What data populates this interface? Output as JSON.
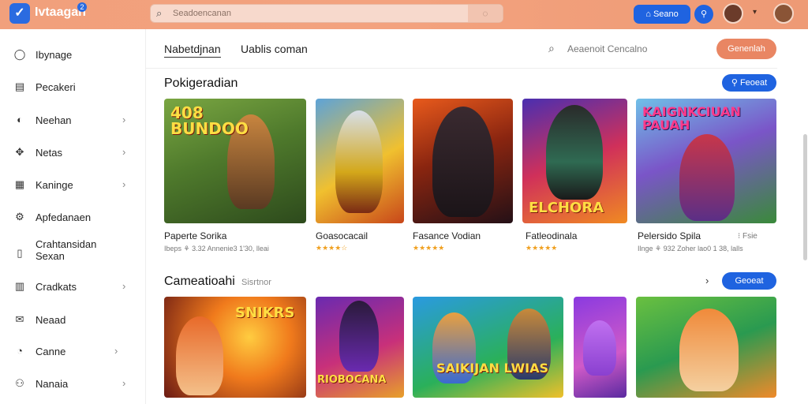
{
  "app": {
    "brand": "Ivtaagan",
    "brand_badge": "2",
    "logo_icon": "checkmark-logo-icon"
  },
  "topbar": {
    "search_placeholder": "Seadoencanan",
    "search_icon": "search-icon",
    "primary_button": "Seano",
    "icon_button": "profile-icon",
    "colors": {
      "bar": "#f1a07c",
      "accent": "#1f63e0"
    }
  },
  "sidebar": {
    "items": [
      {
        "label": "Ibynage",
        "icon": "home-icon",
        "chevron": ""
      },
      {
        "label": "Pecakeri",
        "icon": "clipboard-icon",
        "chevron": ""
      },
      {
        "label": "Neehan",
        "icon": "gamepad-icon",
        "chevron": "›"
      },
      {
        "label": "Netas",
        "icon": "puzzle-icon",
        "chevron": "›"
      },
      {
        "label": "Kaninge",
        "icon": "calendar-icon",
        "chevron": "›"
      },
      {
        "label": "Apfedanaen",
        "icon": "gear-icon",
        "chevron": ""
      },
      {
        "label": "Crahtansidan Sexan",
        "icon": "file-icon",
        "chevron": ""
      },
      {
        "label": "Cradkats",
        "icon": "grid-icon",
        "chevron": "›"
      },
      {
        "label": "Neaad",
        "icon": "mail-icon",
        "chevron": ""
      },
      {
        "label": "Canne",
        "icon": "help-icon",
        "chevron": "›"
      },
      {
        "label": "Nanaia",
        "icon": "user-icon",
        "chevron": "›"
      }
    ]
  },
  "main": {
    "tabs": [
      {
        "label": "Nabetdjnan"
      },
      {
        "label": "Uablis coman"
      }
    ],
    "sub_search_placeholder": "Aeaenoit Cencalno",
    "orange_button": "Genenlah",
    "section1": {
      "title": "Pokigeradian",
      "button": "Feoeat",
      "cards": [
        {
          "title": "Paperte Sorika",
          "meta": "Ibeps ⚘ 3.32 Annenie3 1'30, lleai",
          "stars": "",
          "art_text": "408 BUNDOO"
        },
        {
          "title": "Goasocacail",
          "meta": "",
          "stars": "★★★★☆",
          "art_text": ""
        },
        {
          "title": "Fasance Vodian",
          "meta": "",
          "stars": "★★★★★",
          "art_text": ""
        },
        {
          "title": "Fatleodinala",
          "meta": "",
          "stars": "★★★★★",
          "art_text": "ELCHORA"
        },
        {
          "title": "Pelersido Spila",
          "meta": "Ilnge ⚘ 932 Zoher lao0 1 38, lalls",
          "stars": "",
          "art_text": "KAIGNKCIUAN PAUAH"
        }
      ],
      "extra_label": "⁝ Fsie"
    },
    "section2": {
      "title": "Cameatioahi",
      "subtitle": "Sisrtnor",
      "chevron": "›",
      "button": "Geoeat",
      "cards": [
        {
          "art_text": "SNIKRS"
        },
        {
          "art_text": "RIOBOCANA"
        },
        {
          "art_text": "SAIKIJAN LWIAS"
        },
        {
          "art_text": ""
        },
        {
          "art_text": ""
        }
      ]
    }
  }
}
